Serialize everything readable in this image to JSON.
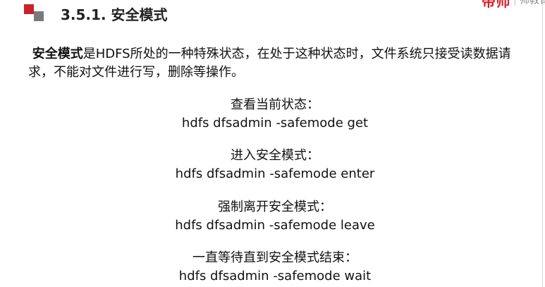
{
  "slide": {
    "title": "3.5.1. 安全模式",
    "brand": {
      "text": "带师",
      "sub": "师教育"
    },
    "intro": {
      "term": "安全模式",
      "text": "是HDFS所处的一种特殊状态，在处于这种状态时，文件系统只接受读数据请求，不能对文件进行写，删除等操作。"
    },
    "commands": [
      {
        "label": "查看当前状态：",
        "code": "hdfs dfsadmin -safemode get"
      },
      {
        "label": "进入安全模式：",
        "code": "hdfs dfsadmin -safemode enter"
      },
      {
        "label": "强制离开安全模式：",
        "code": "hdfs dfsadmin -safemode leave"
      },
      {
        "label": "一直等待直到安全模式结束：",
        "code": "hdfs dfsadmin -safemode wait"
      }
    ],
    "colors": {
      "accent_red": "#c8232c",
      "accent_gray": "#7a7a7a",
      "text": "#111111"
    }
  }
}
